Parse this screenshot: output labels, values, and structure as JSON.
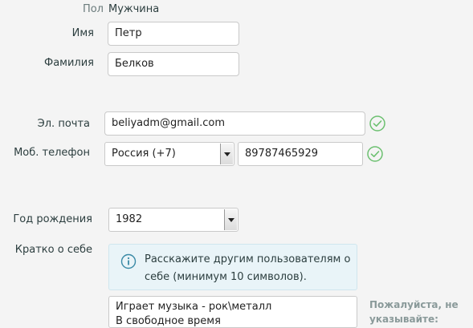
{
  "gender": {
    "label": "Пол",
    "value": "Мужчина"
  },
  "first_name": {
    "label": "Имя",
    "value": "Петр"
  },
  "last_name": {
    "label": "Фамилия",
    "value": "Белков"
  },
  "email": {
    "label": "Эл. почта",
    "value": "beliyadm@gmail.com",
    "status_icon": "check-circle-icon"
  },
  "phone": {
    "label": "Моб. телефон",
    "country": "Россия (+7)",
    "number": "89787465929",
    "status_icon": "check-circle-icon"
  },
  "birth_year": {
    "label": "Год рождения",
    "value": "1982"
  },
  "about": {
    "label": "Кратко о себе",
    "info_icon": "info-circle-icon",
    "info_line1": "Расскажите другим пользователям о",
    "info_line2": "себе (минимум 10 символов).",
    "text_line1": "Играет музыка - рок\\металл",
    "text_line2": "В свободное время",
    "hint_line1": "Пожалуйста, не",
    "hint_line2": "указывайте:"
  },
  "colors": {
    "accent": "#5cb85c",
    "info_bg": "#e9f4f8",
    "info_icon": "#3a8aa6"
  }
}
